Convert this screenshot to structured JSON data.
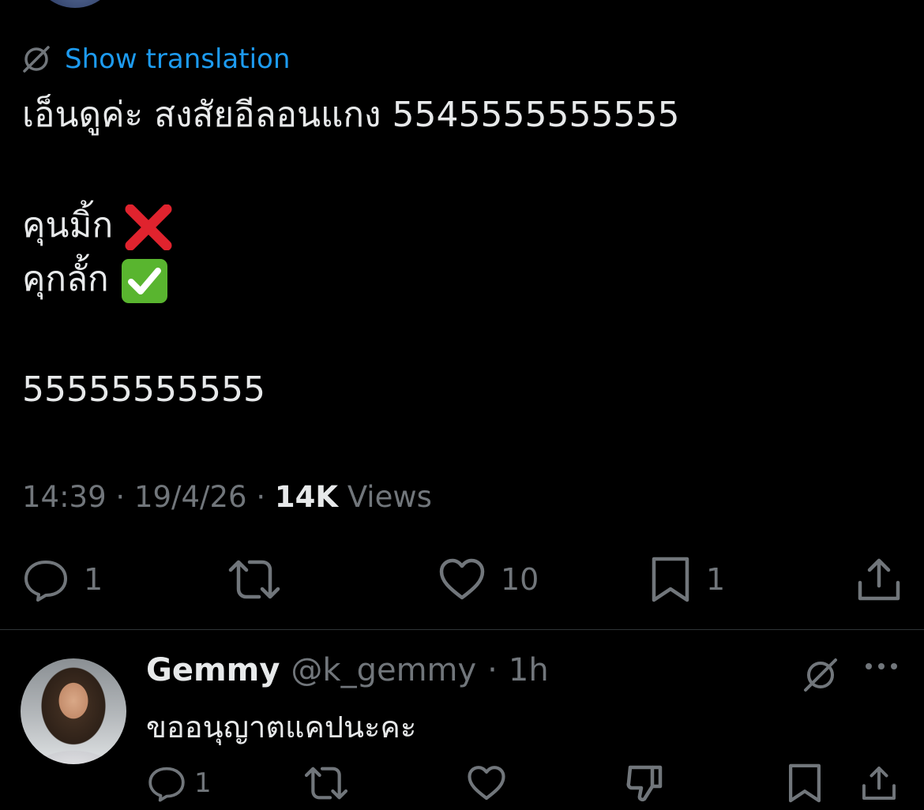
{
  "translation": {
    "label": "Show translation"
  },
  "tweet": {
    "line1": "เอ็นดูค่ะ สงสัยอีลอนแกง 5545555555555",
    "line2": "คุนมิ้ก",
    "line2_emoji": "cross-mark",
    "line3": "คุกลั้ก",
    "line3_emoji": "check-mark",
    "line4": "55555555555"
  },
  "meta": {
    "time": "14:39",
    "date": "19/4/26",
    "views_count": "14K",
    "views_label": "Views"
  },
  "actions": {
    "reply_count": "1",
    "retweet_count": "",
    "like_count": "10",
    "bookmark_count": "1"
  },
  "reply": {
    "name": "Gemmy",
    "handle": "@k_gemmy",
    "age": "1h",
    "text": "ขออนุญาตแคปนะคะ",
    "reply_count": "1"
  },
  "colors": {
    "background": "#000000",
    "accent": "#1d9bf0",
    "text": "#e7e9ea",
    "muted": "#71767b"
  }
}
